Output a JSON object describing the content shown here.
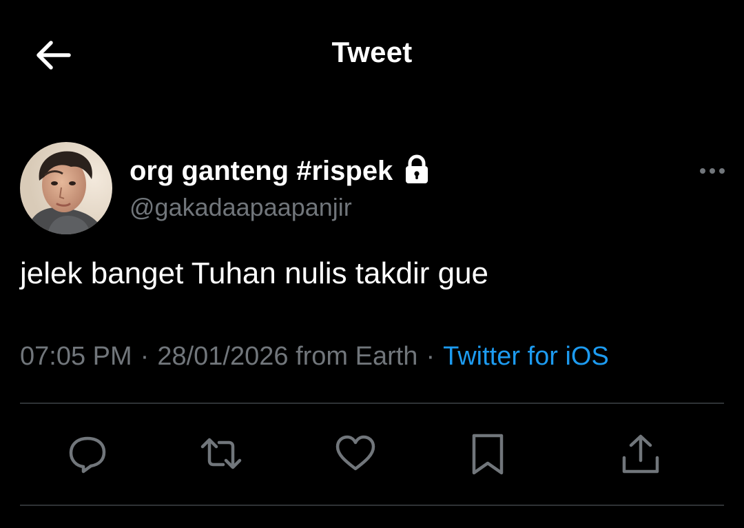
{
  "header": {
    "title": "Tweet",
    "back_icon": "arrow-left-icon"
  },
  "tweet": {
    "author": {
      "display_name": "org ganteng #rispek",
      "handle": "@gakadaapaapanjir",
      "protected_icon": "lock-icon",
      "avatar": "avatar-photo"
    },
    "text": "jelek banget Tuhan nulis takdir gue",
    "time": "07:05 PM",
    "date": "28/01/2026",
    "location": "from Earth",
    "separator": "·",
    "source": "Twitter for iOS"
  },
  "actions": [
    {
      "name": "reply",
      "icon": "reply-icon"
    },
    {
      "name": "retweet",
      "icon": "retweet-icon"
    },
    {
      "name": "like",
      "icon": "heart-icon"
    },
    {
      "name": "bookmark",
      "icon": "bookmark-icon"
    },
    {
      "name": "share",
      "icon": "share-icon"
    }
  ],
  "colors": {
    "background": "#000000",
    "text_primary": "#ffffff",
    "text_secondary": "#71767b",
    "link": "#1d9bf0",
    "divider": "#2f3336"
  }
}
